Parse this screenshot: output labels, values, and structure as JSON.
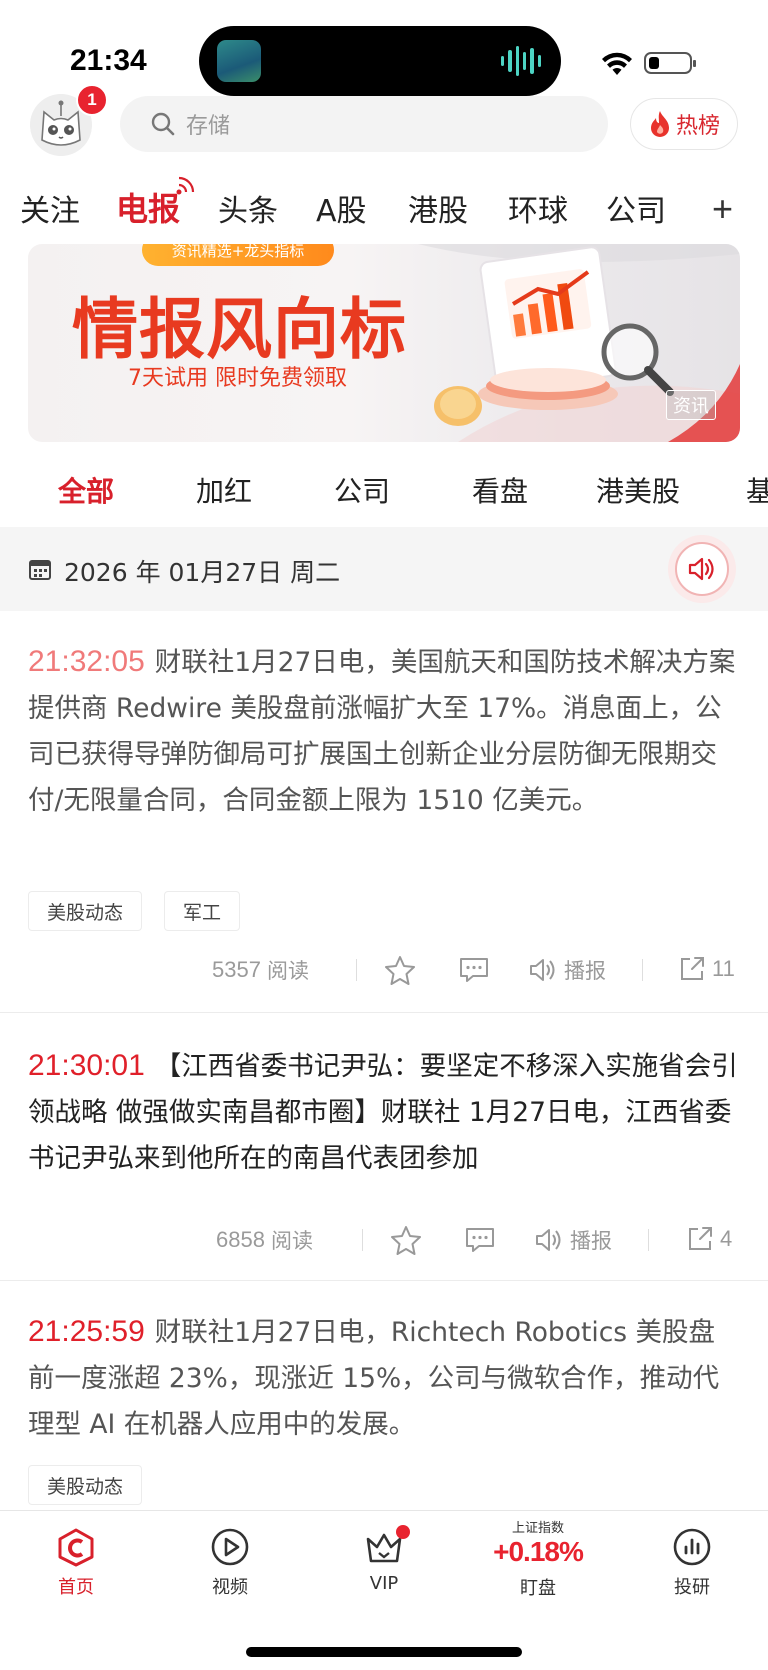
{
  "status_bar": {
    "time": "21:34"
  },
  "header": {
    "badge_count": "1",
    "search_placeholder": "存储",
    "hot_label": "热榜"
  },
  "top_nav": {
    "items": [
      "关注",
      "电报",
      "头条",
      "A股",
      "港股",
      "环球",
      "公司"
    ],
    "active": "电报"
  },
  "banner": {
    "pill": "资讯精选+龙头指标",
    "title": "情报风向标",
    "subtitle": "7天试用 限时免费领取",
    "tag": "资讯"
  },
  "category_tabs": {
    "items": [
      "全部",
      "加红",
      "公司",
      "看盘",
      "港美股",
      "基"
    ],
    "active": "全部"
  },
  "date_bar": {
    "date": "2026 年 01月27日  周二"
  },
  "feed": [
    {
      "time": "21:32:05",
      "text": "财联社1月27日电，美国航天和国防技术解决方案提供商 Redwire 美股盘前涨幅扩大至 17%。消息面上，公司已获得导弹防御局可扩展国土创新企业分层防御无限期交付/无限量合同，合同金额上限为 1510 亿美元。",
      "tags": [
        "美股动态",
        "军工"
      ],
      "reads": "5357",
      "reads_label": "阅读",
      "broadcast_label": "播报",
      "shares": "11"
    },
    {
      "time": "21:30:01",
      "text": "【江西省委书记尹弘：要坚定不移深入实施省会引领战略 做强做实南昌都市圈】财联社 1月27日电，江西省委书记尹弘来到他所在的南昌代表团参加",
      "tags": [],
      "reads": "6858",
      "reads_label": "阅读",
      "broadcast_label": "播报",
      "shares": "4"
    },
    {
      "time": "21:25:59",
      "text": "财联社1月27日电，Richtech Robotics 美股盘前一度涨超 23%，现涨近 15%，公司与微软合作，推动代理型 AI 在机器人应用中的发展。",
      "tags": [
        "美股动态"
      ]
    }
  ],
  "tab_bar": {
    "home": "首页",
    "video": "视频",
    "vip": "VIP",
    "index_name": "上证指数",
    "index_value": "+0.18%",
    "watch": "盯盘",
    "research": "投研"
  },
  "colors": {
    "brand_red": "#d8202b",
    "time_light": "#f07a7a",
    "time_red": "#e0202a"
  },
  "icons": [
    "search-icon",
    "flame-icon",
    "calendar-icon",
    "speaker-icon",
    "star-icon",
    "comment-icon",
    "share-icon",
    "home-icon",
    "play-icon",
    "crown-icon",
    "chart-icon"
  ]
}
